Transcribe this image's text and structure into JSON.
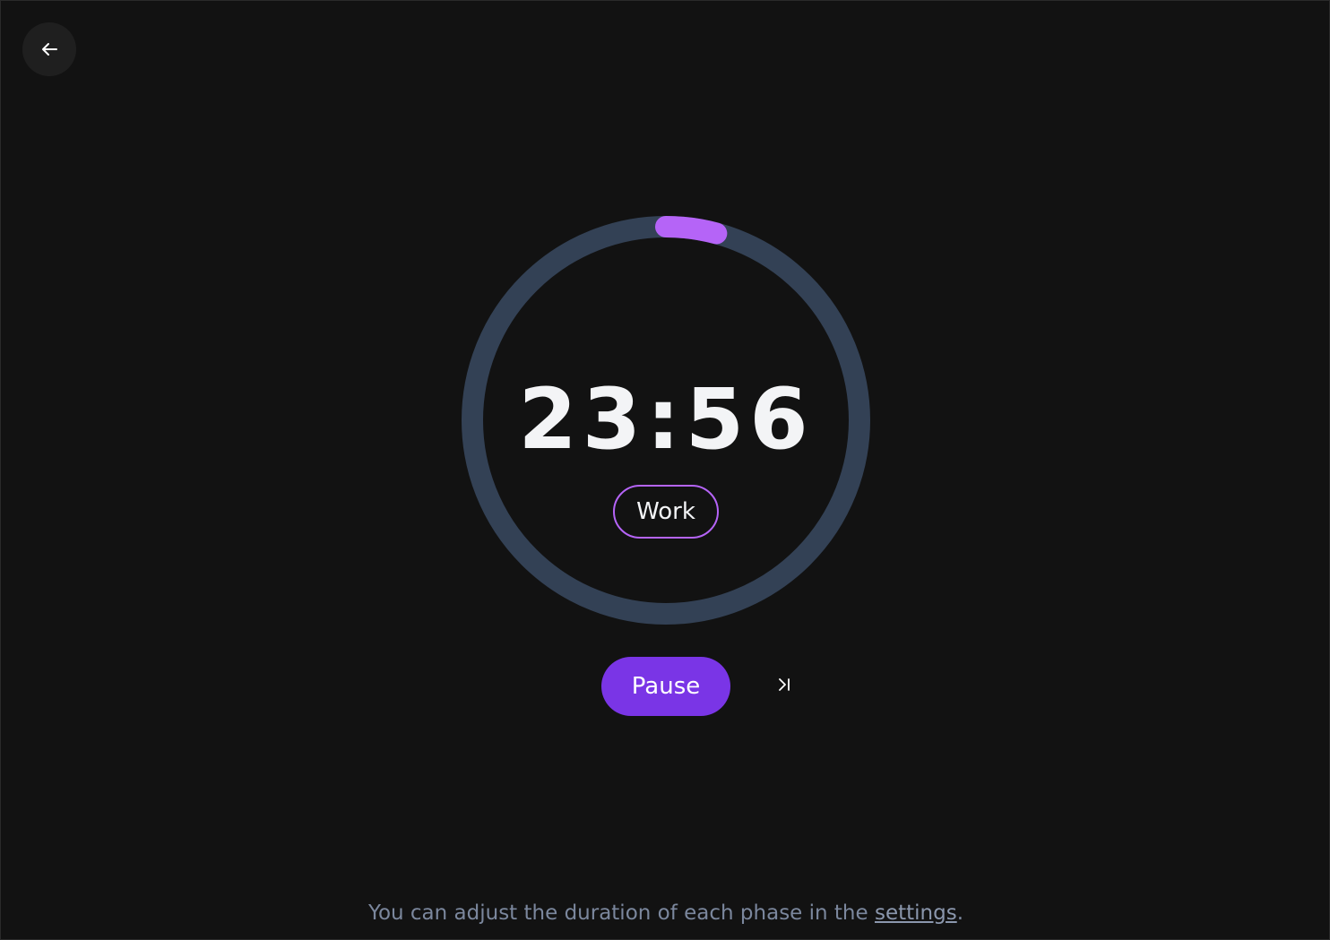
{
  "header": {
    "back_icon": "arrow-left-icon"
  },
  "timer": {
    "time": "23:56",
    "phase": "Work",
    "progress": 0.042,
    "colors": {
      "track": "#334155",
      "progress": "#b564f7",
      "phase_border": "#b564f7"
    }
  },
  "controls": {
    "pause_label": "Pause",
    "pause_color": "#7a35e6",
    "skip_icon": "skip-next-icon"
  },
  "footer": {
    "text_before": "You can adjust the duration of each phase in the ",
    "link_label": "settings",
    "text_after": "."
  }
}
